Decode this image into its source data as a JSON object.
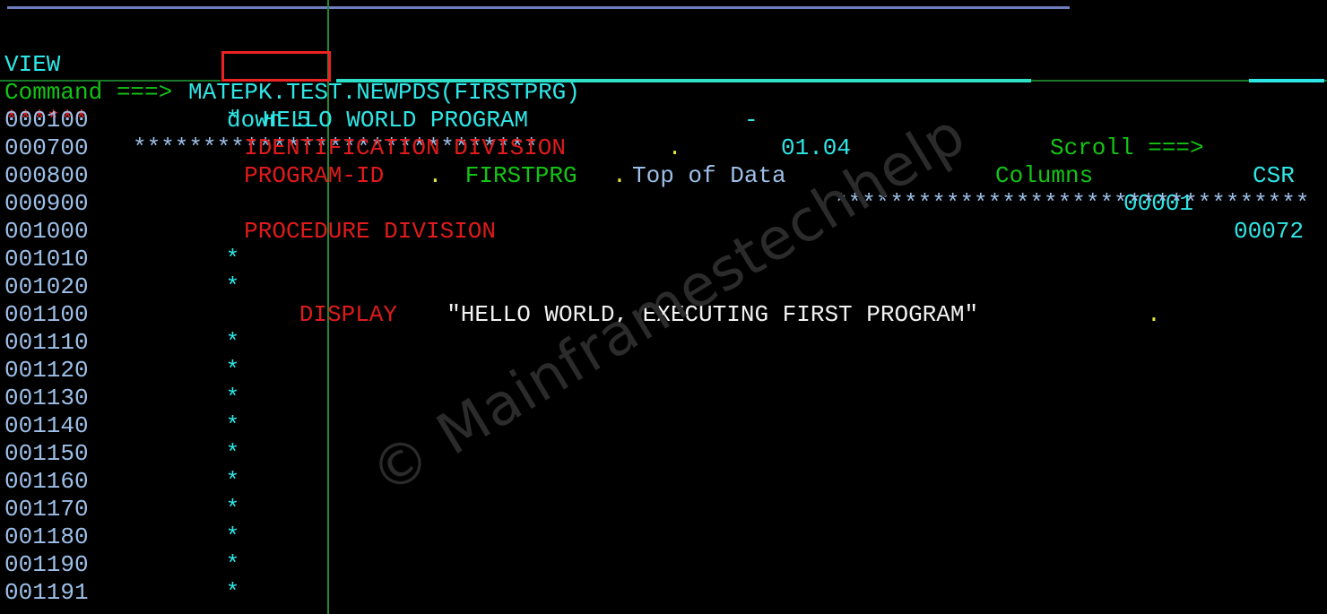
{
  "terminal": {
    "panel_id": "VIEW",
    "dataset": "MATEPK.TEST.NEWPDS(FIRSTPRG)",
    "dash": "-",
    "version": "01.04",
    "columns_label": "Columns",
    "columns_from": "00001",
    "columns_to": "00072",
    "command_label": "Command ===>",
    "command_value": "down 5",
    "scroll_label": "Scroll ===>",
    "scroll_value": "CSR",
    "top_of_data_text": "Top of Data",
    "marker_left": "******",
    "marker_stars_left": "*****************************",
    "marker_stars_right": "**********************************",
    "watermark": "© Mainframestechhelp"
  },
  "colors": {
    "background": "#000000",
    "cyan": "#2fe6e6",
    "green": "#14c414",
    "red": "#e01b1b",
    "white": "#f2f2f2",
    "light_blue": "#9dbfe8",
    "yellow": "#e8e832",
    "annotation_red": "#ee2222",
    "top_rule_blue": "#6f7fbe",
    "column_rule_green": "#1f8a2e"
  },
  "editor": {
    "lines": [
      {
        "number": "000100",
        "segments": [
          {
            "text": "* ",
            "color": "cyan"
          },
          {
            "text": "HELLO WORLD PROGRAM",
            "color": "cyan"
          }
        ]
      },
      {
        "number": "000700",
        "segments": [
          {
            "text": "IDENTIFICATION DIVISION",
            "color": "red"
          },
          {
            "text": ".",
            "color": "yellow"
          }
        ]
      },
      {
        "number": "000800",
        "segments": [
          {
            "text": "PROGRAM-ID",
            "color": "red"
          },
          {
            "text": ".",
            "color": "yellow"
          },
          {
            "text": " ",
            "color": "red"
          },
          {
            "text": "FIRSTPRG",
            "color": "green"
          },
          {
            "text": ".",
            "color": "yellow"
          }
        ]
      },
      {
        "number": "000900",
        "segments": []
      },
      {
        "number": "001000",
        "segments": [
          {
            "text": "PROCEDURE DIVISION",
            "color": "red"
          }
        ]
      },
      {
        "number": "001010",
        "segments": [
          {
            "text": "*",
            "color": "cyan"
          }
        ]
      },
      {
        "number": "001020",
        "segments": [
          {
            "text": "*",
            "color": "cyan"
          }
        ]
      },
      {
        "number": "001100",
        "segments": [
          {
            "text": "DISPLAY ",
            "color": "red"
          },
          {
            "text": "\"HELLO WORLD, EXECUTING FIRST PROGRAM\"",
            "color": "white"
          },
          {
            "text": ".",
            "color": "yellow"
          }
        ]
      },
      {
        "number": "001110",
        "segments": [
          {
            "text": "*",
            "color": "cyan"
          }
        ]
      },
      {
        "number": "001120",
        "segments": [
          {
            "text": "*",
            "color": "cyan"
          }
        ]
      },
      {
        "number": "001130",
        "segments": [
          {
            "text": "*",
            "color": "cyan"
          }
        ]
      },
      {
        "number": "001140",
        "segments": [
          {
            "text": "*",
            "color": "cyan"
          }
        ]
      },
      {
        "number": "001150",
        "segments": [
          {
            "text": "*",
            "color": "cyan"
          }
        ]
      },
      {
        "number": "001160",
        "segments": [
          {
            "text": "*",
            "color": "cyan"
          }
        ]
      },
      {
        "number": "001170",
        "segments": [
          {
            "text": "*",
            "color": "cyan"
          }
        ]
      },
      {
        "number": "001180",
        "segments": [
          {
            "text": "*",
            "color": "cyan"
          }
        ]
      },
      {
        "number": "001190",
        "segments": [
          {
            "text": "*",
            "color": "cyan"
          }
        ]
      },
      {
        "number": "001191",
        "segments": [
          {
            "text": "*",
            "color": "cyan"
          }
        ]
      }
    ],
    "line_indent_cols": {
      "comment_star": 12,
      "code": 13,
      "display": 16
    }
  }
}
